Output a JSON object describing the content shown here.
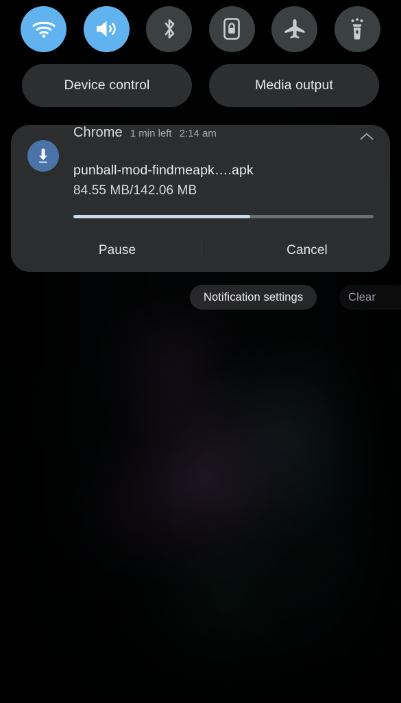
{
  "quick_settings": {
    "toggles": [
      {
        "name": "wifi",
        "icon": "wifi-icon",
        "label": "Wi-Fi",
        "state": "on"
      },
      {
        "name": "sound",
        "icon": "volume-icon",
        "label": "Sound",
        "state": "on"
      },
      {
        "name": "bluetooth",
        "icon": "bluetooth-icon",
        "label": "Bluetooth",
        "state": "off"
      },
      {
        "name": "auto-rotate",
        "icon": "rotation-lock-icon",
        "label": "Auto rotate",
        "state": "off"
      },
      {
        "name": "airplane",
        "icon": "airplane-icon",
        "label": "Airplane mode",
        "state": "off"
      },
      {
        "name": "flashlight",
        "icon": "flashlight-icon",
        "label": "Flashlight",
        "state": "off"
      }
    ],
    "active_color": "#61b3ef",
    "inactive_color": "#3b4043",
    "pills": {
      "device_control": "Device control",
      "media_output": "Media output"
    }
  },
  "notification": {
    "app_name": "Chrome",
    "time_left": "1 min left",
    "timestamp": "2:14 am",
    "title": "punball-mod-findmeapk….apk",
    "subtext": "84.55 MB/142.06 MB",
    "progress": {
      "downloaded_mb": 84.55,
      "total_mb": 142.06,
      "percent": 59,
      "fill_color": "#ccd8ec",
      "track_color": "#6c6f71"
    },
    "actions": {
      "pause": "Pause",
      "cancel": "Cancel"
    },
    "collapse_icon": "chevron-up-icon",
    "app_icon": "download-icon",
    "app_icon_color": "#4a73a8",
    "card_color": "#2c2d2e"
  },
  "footer": {
    "notification_settings": "Notification settings",
    "clear": "Clear"
  }
}
